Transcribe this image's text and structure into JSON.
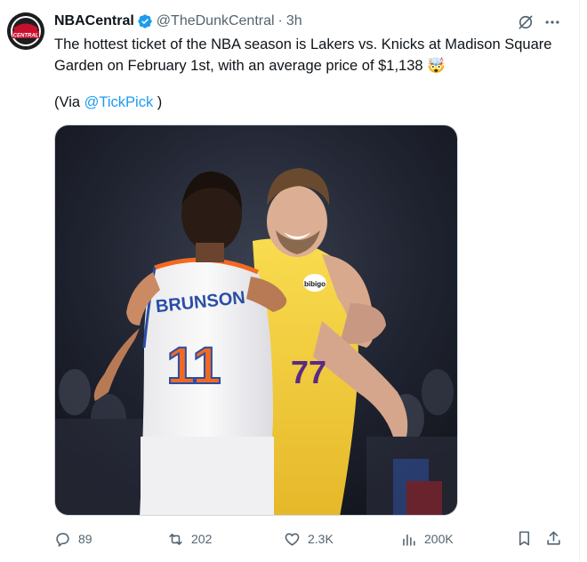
{
  "tweet": {
    "author": {
      "name": "NBACentral",
      "handle": "@TheDunkCentral",
      "avatar_label": "CENTRAL"
    },
    "separator": "·",
    "time": "3h",
    "text": "The hottest ticket of the NBA season is Lakers vs. Knicks at Madison Square Garden on February 1st, with an average price of $1,138",
    "emoji": "🤯",
    "via_prefix": "(Via ",
    "via_link": "@TickPick",
    "via_suffix": " )",
    "media": {
      "jersey_left_name": "BRUNSON",
      "jersey_left_number": "11",
      "jersey_right_number": "77",
      "jersey_right_sponsor": "bibigo"
    },
    "stats": {
      "replies": "89",
      "reposts": "202",
      "likes": "2.3K",
      "views": "200K"
    }
  },
  "colors": {
    "verified": "#1d9bf0",
    "link": "#1d9bf0",
    "muted": "#536471",
    "lakers_gold": "#f7d23e",
    "knicks_orange": "#f26a21",
    "knicks_blue": "#2a4ea5"
  },
  "icons": [
    "verified-badge-icon",
    "grok-icon",
    "more-icon",
    "reply-icon",
    "repost-icon",
    "like-icon",
    "views-icon",
    "bookmark-icon",
    "share-icon"
  ]
}
